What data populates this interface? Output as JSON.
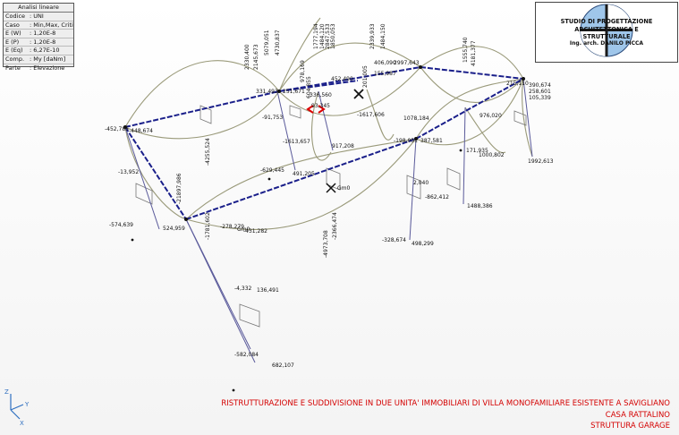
{
  "infobox": {
    "title": "Analisi lineare",
    "rows": [
      {
        "k": "Codice",
        "v": ": UNI"
      },
      {
        "k": "Caso",
        "v": ": Min,Max, Critici"
      },
      {
        "k": "E (W)",
        "v": ": 1,20E-8"
      },
      {
        "k": "E (P)",
        "v": ": 1,20E-8"
      },
      {
        "k": "E (Eq)",
        "v": ": 6,27E-10"
      },
      {
        "k": "Comp.",
        "v": ": My [daNm]"
      },
      {
        "k": "Parte",
        "v": ": Elevazione"
      }
    ]
  },
  "logo": {
    "line1": "STUDIO DI PROGETTAZIONE",
    "line2": "ARCHITETTONICA E STRUTTURALE",
    "line3": "Ing. arch. DANILO PICCA"
  },
  "caption": {
    "line1": "RISTRUTTURAZIONE E SUDDIVISIONE IN DUE UNITA' IMMOBILIARI DI VILLA MONOFAMILIARE ESISTENTE A SAVIGLIANO",
    "line2": "CASA RATTALINO",
    "line3": "STRUTTURA GARAGE"
  },
  "axes": {
    "z": "Z",
    "y": "Y",
    "x": "X"
  },
  "labels": [
    {
      "t": "5079,051"
    },
    {
      "t": "4730,837"
    },
    {
      "t": "2145,673"
    },
    {
      "t": "2330,400"
    },
    {
      "t": "1777,194"
    },
    {
      "t": "1484,120"
    },
    {
      "t": "2847,533"
    },
    {
      "t": "1850,053"
    },
    {
      "t": "978,169"
    },
    {
      "t": "604,855"
    },
    {
      "t": "452,490"
    },
    {
      "t": "331,493"
    },
    {
      "t": "251,671"
    },
    {
      "t": "336,560"
    },
    {
      "t": "93,345"
    },
    {
      "t": "2339,933"
    },
    {
      "t": "1484,150"
    },
    {
      "t": "406,090"
    },
    {
      "t": "2997,643"
    },
    {
      "t": "155,987"
    },
    {
      "t": "201,005"
    },
    {
      "t": "1555,740"
    },
    {
      "t": "4181,377"
    },
    {
      "t": "390,674"
    },
    {
      "t": "258,601"
    },
    {
      "t": "105,339"
    },
    {
      "t": "215,110"
    },
    {
      "t": "976,020"
    },
    {
      "t": "1992,613"
    },
    {
      "t": "1000,802"
    },
    {
      "t": "171,935"
    },
    {
      "t": "-1613,657"
    },
    {
      "t": "917,208"
    },
    {
      "t": "-1617,606"
    },
    {
      "t": "1078,184"
    },
    {
      "t": "-198,051"
    },
    {
      "t": "387,581"
    },
    {
      "t": "-452,785"
    },
    {
      "t": "-448,674"
    },
    {
      "t": "-91,753"
    },
    {
      "t": "-629,445"
    },
    {
      "t": "491,205"
    },
    {
      "t": "-4255,524"
    },
    {
      "t": "-13,952"
    },
    {
      "t": "-21897,986"
    },
    {
      "t": "-574,639"
    },
    {
      "t": "524,959"
    },
    {
      "t": "-1781,602"
    },
    {
      "t": "-278,279"
    },
    {
      "t": "-431,282"
    },
    {
      "t": "-4973,708"
    },
    {
      "t": "-2366,474"
    },
    {
      "t": "-862,412"
    },
    {
      "t": "1488,386"
    },
    {
      "t": "-328,674"
    },
    {
      "t": "498,299"
    },
    {
      "t": "-4,332"
    },
    {
      "t": "136,491"
    },
    {
      "t": "-582,084"
    },
    {
      "t": "682,107"
    },
    {
      "t": "2,040"
    },
    {
      "t": "Gm0"
    },
    {
      "t": "Gm0"
    }
  ],
  "colors": {
    "beam": "#1a1f8a",
    "diagram": "#9a9a7a",
    "column": "#5a5a9a",
    "caption": "#d40000"
  }
}
